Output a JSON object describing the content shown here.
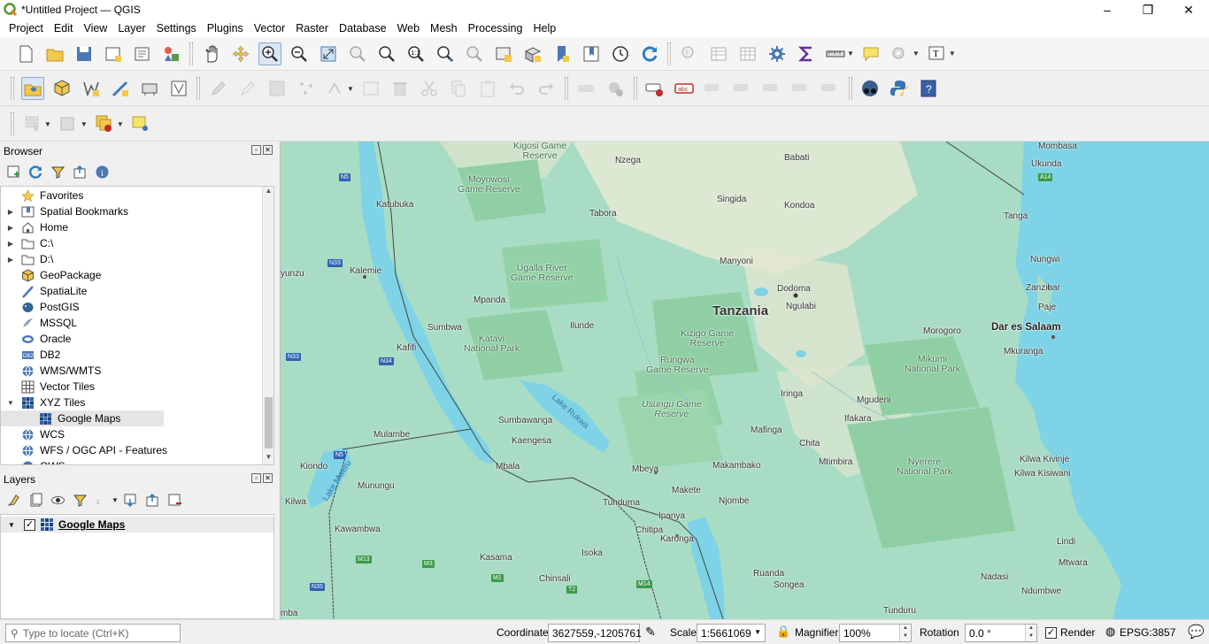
{
  "window": {
    "title": "*Untitled Project — QGIS",
    "min": "–",
    "max": "❐",
    "close": "✕"
  },
  "menu": [
    "Project",
    "Edit",
    "View",
    "Layer",
    "Settings",
    "Plugins",
    "Vector",
    "Raster",
    "Database",
    "Web",
    "Mesh",
    "Processing",
    "Help"
  ],
  "browser": {
    "title": "Browser",
    "items": [
      {
        "label": "Favorites",
        "icon": "star-icon",
        "arrow": ""
      },
      {
        "label": "Spatial Bookmarks",
        "icon": "bookmark-icon",
        "arrow": "▶"
      },
      {
        "label": "Home",
        "icon": "home-icon",
        "arrow": "▶"
      },
      {
        "label": "C:\\",
        "icon": "folder-icon",
        "arrow": "▶"
      },
      {
        "label": "D:\\",
        "icon": "folder-icon",
        "arrow": "▶"
      },
      {
        "label": "GeoPackage",
        "icon": "geopackage-icon",
        "arrow": ""
      },
      {
        "label": "SpatiaLite",
        "icon": "spatialite-icon",
        "arrow": ""
      },
      {
        "label": "PostGIS",
        "icon": "postgis-icon",
        "arrow": ""
      },
      {
        "label": "MSSQL",
        "icon": "mssql-icon",
        "arrow": ""
      },
      {
        "label": "Oracle",
        "icon": "oracle-icon",
        "arrow": ""
      },
      {
        "label": "DB2",
        "icon": "db2-icon",
        "arrow": ""
      },
      {
        "label": "WMS/WMTS",
        "icon": "wms-icon",
        "arrow": ""
      },
      {
        "label": "Vector Tiles",
        "icon": "vector-tiles-icon",
        "arrow": ""
      },
      {
        "label": "XYZ Tiles",
        "icon": "xyz-tiles-icon",
        "arrow": "▼"
      },
      {
        "label": "Google Maps",
        "icon": "xyz-tiles-icon",
        "arrow": ""
      },
      {
        "label": "WCS",
        "icon": "wcs-icon",
        "arrow": ""
      },
      {
        "label": "WFS / OGC API - Features",
        "icon": "wfs-icon",
        "arrow": ""
      },
      {
        "label": "OWS",
        "icon": "ows-icon",
        "arrow": ""
      }
    ]
  },
  "layers": {
    "title": "Layers",
    "items": [
      {
        "label": "Google Maps",
        "checked": "✓"
      }
    ]
  },
  "map": {
    "country": "Tanzania",
    "labels": {
      "mombasa": "Mombasa",
      "ukunda": "Ukunda",
      "tanga": "Tanga",
      "nungwi": "Nungwi",
      "zanzibar": "Zanzibar",
      "paje": "Paje",
      "dar": "Dar es Salaam",
      "mkuranga": "Mkuranga",
      "morogoro": "Morogoro",
      "dodoma": "Dodoma",
      "ngulabi": "Ngulabi",
      "kondoa": "Kondoa",
      "babati": "Babati",
      "singida": "Singida",
      "manyoni": "Manyoni",
      "nzega": "Nzega",
      "tabora": "Tabora",
      "katubuka": "Katubuka",
      "kalemie": "Kalemie",
      "mpanda": "Mpanda",
      "ilunde": "Ilunde",
      "sumbwa": "Sumbwa",
      "kafifi": "Kafifi",
      "sumbawanga": "Sumbawanga",
      "kaengesa": "Kaengesa",
      "mulambe": "Mulambe",
      "mbala": "Mbala",
      "kiondo": "Kiondo",
      "munungu": "Munungu",
      "kilwa": "Kilwa",
      "kawambwa": "Kawambwa",
      "kasama": "Kasama",
      "isoka": "Isoka",
      "chinsali": "Chinsali",
      "tunduma": "Tunduma",
      "chitipa": "Chitipa",
      "ipanya": "Ipanya",
      "karonga": "Karonga",
      "mbeya": "Mbeya",
      "makete": "Makete",
      "makambako": "Makambako",
      "njombe": "Njombe",
      "mafinga": "Mafinga",
      "iringa": "Iringa",
      "chita": "Chita",
      "mtimbira": "Mtimbira",
      "ifakara": "Ifakara",
      "mgudeni": "Mgudeni",
      "ruanda": "Ruanda",
      "songea": "Songea",
      "tunduru": "Tunduru",
      "nadasi": "Nadasi",
      "ndumbwe": "Ndumbwe",
      "mtwara": "Mtwara",
      "lindi": "Lindi",
      "kilwa_kivinje": "Kilwa Kivinje",
      "kilwa_kisiwani": "Kilwa Kisiwani",
      "yunzu": "yunzu",
      "mba": "mba",
      "kigosi": "Kigosi Game\nReserve"
    },
    "parks": {
      "moyowosi": "Moyowosi\nGame Reserve",
      "ugalla": "Ugalla River\nGame Reserve",
      "katavi": "Katavi\nNational Park",
      "kizigo": "Kizigo Game\nReserve",
      "rungwa": "Rungwa\nGame Reserve",
      "usungu": "Usungu Game\nReserve",
      "mikumi": "Mikumi\nNational Park",
      "nyerere": "Nyerere\nNational Park"
    },
    "lakes": {
      "rukwa": "Lake Rukwa",
      "mweru": "Lake Mweru"
    },
    "roads": {
      "n5a": "N5",
      "n33a": "N33",
      "n33b": "N33",
      "n34": "N34",
      "n5b": "N5",
      "n35": "N35",
      "m13": "M13",
      "m3": "M3",
      "m1": "M1",
      "t2": "T2",
      "m14": "M14",
      "a14": "A14"
    }
  },
  "status": {
    "locate_placeholder": "Type to locate (Ctrl+K)",
    "coordinate_label": "Coordinate",
    "coordinate": "3627559,-1205761",
    "scale_label": "Scale",
    "scale": "1:5661069",
    "magnifier_label": "Magnifier",
    "magnifier": "100%",
    "rotation_label": "Rotation",
    "rotation": "0.0 °",
    "render_label": "Render",
    "render_checked": "✓",
    "crs": "EPSG:3857"
  },
  "colors": {
    "water": "#7ed3e6",
    "land": "#a9dcc4",
    "park": "#8fcfa3",
    "arid": "#e8ead6"
  }
}
